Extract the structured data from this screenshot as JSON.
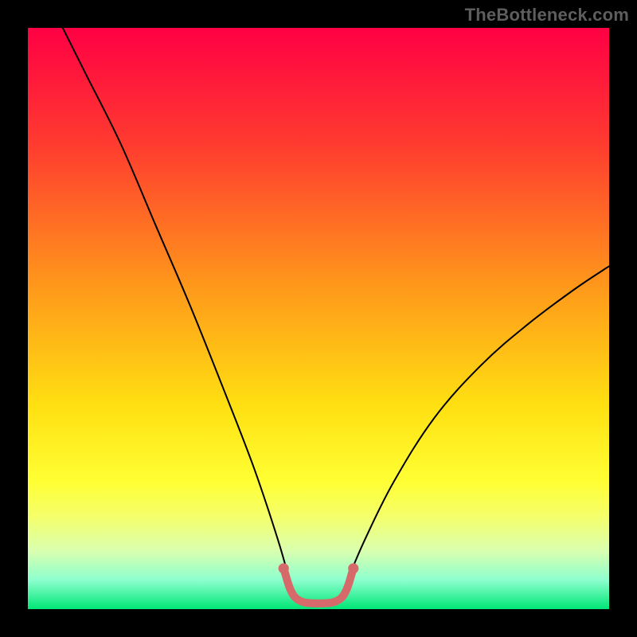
{
  "watermark": "TheBottleneck.com",
  "chart_data": {
    "type": "line",
    "title": "",
    "xlabel": "",
    "ylabel": "",
    "xlim": [
      0,
      100
    ],
    "ylim": [
      0,
      100
    ],
    "grid": false,
    "legend": false,
    "gradient_stops": [
      {
        "offset": 0,
        "color": "#ff0044"
      },
      {
        "offset": 20,
        "color": "#ff3b2f"
      },
      {
        "offset": 45,
        "color": "#ff9a1a"
      },
      {
        "offset": 65,
        "color": "#ffe012"
      },
      {
        "offset": 78,
        "color": "#ffff33"
      },
      {
        "offset": 84,
        "color": "#f5ff6a"
      },
      {
        "offset": 90,
        "color": "#d9ffb0"
      },
      {
        "offset": 95,
        "color": "#8dffce"
      },
      {
        "offset": 100,
        "color": "#00e676"
      }
    ],
    "series": [
      {
        "name": "left-curve",
        "stroke": "#000000",
        "stroke_width": 2.0,
        "points": [
          {
            "x": 6,
            "y": 100
          },
          {
            "x": 10,
            "y": 92
          },
          {
            "x": 16,
            "y": 80
          },
          {
            "x": 22,
            "y": 66
          },
          {
            "x": 28,
            "y": 52
          },
          {
            "x": 34,
            "y": 37
          },
          {
            "x": 39,
            "y": 24
          },
          {
            "x": 43,
            "y": 12
          },
          {
            "x": 45,
            "y": 5
          }
        ]
      },
      {
        "name": "right-curve",
        "stroke": "#000000",
        "stroke_width": 2.0,
        "points": [
          {
            "x": 55,
            "y": 5
          },
          {
            "x": 58,
            "y": 12
          },
          {
            "x": 63,
            "y": 22
          },
          {
            "x": 70,
            "y": 33
          },
          {
            "x": 78,
            "y": 42
          },
          {
            "x": 86,
            "y": 49
          },
          {
            "x": 94,
            "y": 55
          },
          {
            "x": 100,
            "y": 59
          }
        ]
      },
      {
        "name": "trough-band",
        "stroke": "#d66a6a",
        "stroke_width": 10,
        "points": [
          {
            "x": 44,
            "y": 7
          },
          {
            "x": 46,
            "y": 2
          },
          {
            "x": 50,
            "y": 1
          },
          {
            "x": 54,
            "y": 2
          },
          {
            "x": 56,
            "y": 7
          }
        ]
      }
    ],
    "trough_endpoints": [
      {
        "x": 44,
        "y": 7
      },
      {
        "x": 56,
        "y": 7
      }
    ]
  }
}
